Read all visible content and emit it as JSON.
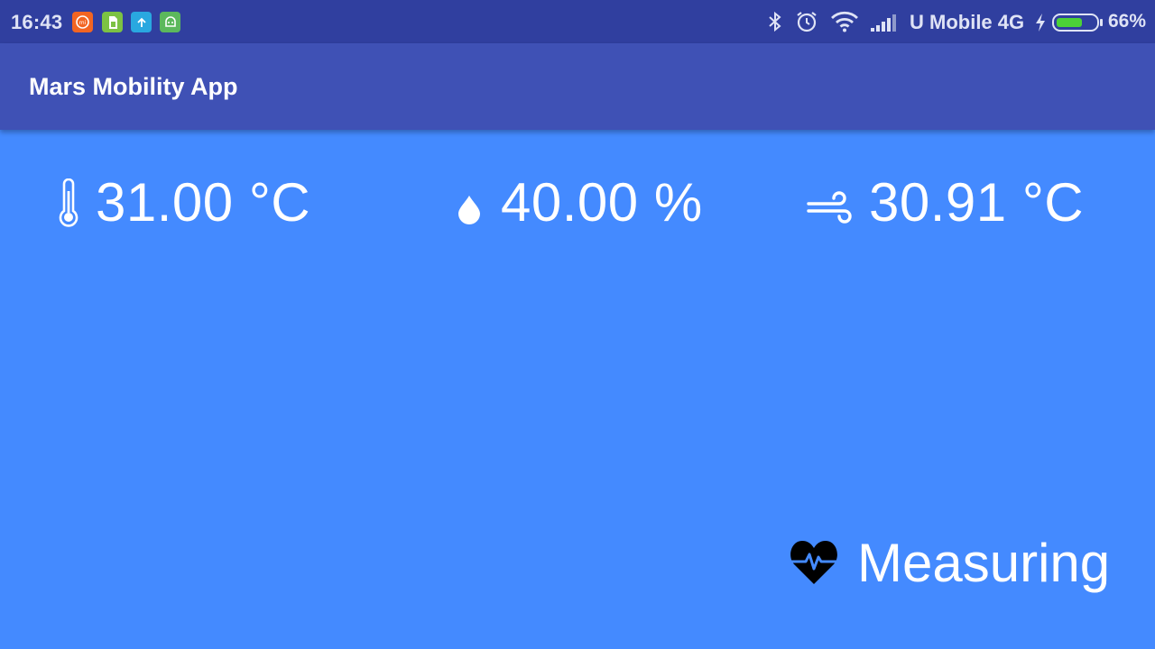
{
  "status_bar": {
    "time": "16:43",
    "carrier": "U Mobile 4G",
    "battery_percent": "66%",
    "battery_level": 0.66,
    "notification_icons": [
      "mi-icon",
      "sim-icon",
      "upload-icon",
      "android-icon"
    ],
    "system_icons": [
      "bluetooth-icon",
      "alarm-icon",
      "wifi-icon",
      "signal-icon",
      "charging-icon",
      "battery-icon"
    ]
  },
  "app_bar": {
    "title": "Mars Mobility App",
    "color": "#3f51b5"
  },
  "readings": {
    "temperature": {
      "icon": "thermometer-icon",
      "value": "31.00 °C"
    },
    "humidity": {
      "icon": "water-drop-icon",
      "value": "40.00 %"
    },
    "wind_chill": {
      "icon": "wind-icon",
      "value": "30.91 °C"
    }
  },
  "status": {
    "icon": "heart-pulse-icon",
    "label": "Measuring"
  },
  "colors": {
    "status_bar": "#303f9f",
    "background": "#448aff",
    "battery_fill": "#4cd137"
  }
}
